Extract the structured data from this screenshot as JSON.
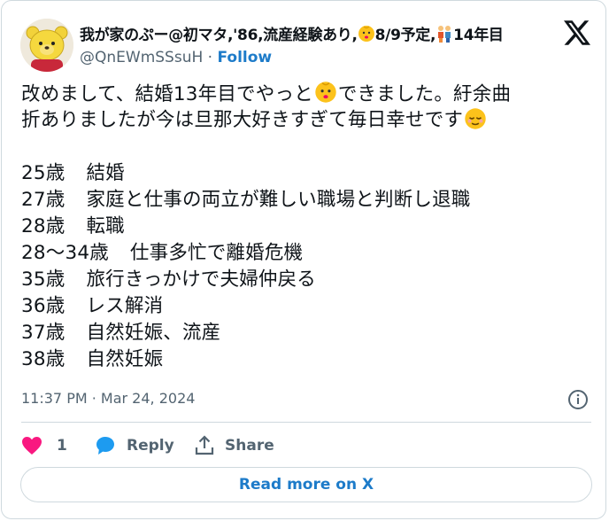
{
  "author": {
    "name": "我が家のぷー@初マタ,'86,流産経験あり,",
    "name_part2": "8/9予定,",
    "name_part3": "14年目",
    "handle": "@QnEWmSSsuH",
    "separator": "·",
    "follow_label": "Follow"
  },
  "tweet": {
    "intro_line1_a": "改めまして、結婚13年目でやっと",
    "intro_line1_b": "できました。紆余曲",
    "intro_line2": "折ありましたが今は旦那大好きすぎて毎日幸せです",
    "timeline": [
      {
        "age": "25歳",
        "event": "結婚"
      },
      {
        "age": "27歳",
        "event": "家庭と仕事の両立が難しい職場と判断し退職"
      },
      {
        "age": "28歳",
        "event": "転職"
      },
      {
        "age": "28〜34歳",
        "event": "仕事多忙で離婚危機"
      },
      {
        "age": "35歳",
        "event": "旅行きっかけで夫婦仲戻る"
      },
      {
        "age": "36歳",
        "event": "レス解消"
      },
      {
        "age": "37歳",
        "event": "自然妊娠、流産"
      },
      {
        "age": "38歳",
        "event": "自然妊娠"
      }
    ],
    "timestamp": "11:37 PM · Mar 24, 2024"
  },
  "actions": {
    "like_count": "1",
    "reply_label": "Reply",
    "share_label": "Share"
  },
  "read_more_label": "Read more on X",
  "colors": {
    "accent": "#1d7bc9",
    "like": "#f91880",
    "text": "#0f1419",
    "muted": "#536471",
    "border": "#cfd9de"
  },
  "icons": [
    "avatar-bear",
    "baby-emoji",
    "family-emoji",
    "x-logo",
    "info-icon",
    "heart-icon",
    "reply-bubble-icon",
    "share-icon",
    "relieved-face-emoji"
  ]
}
